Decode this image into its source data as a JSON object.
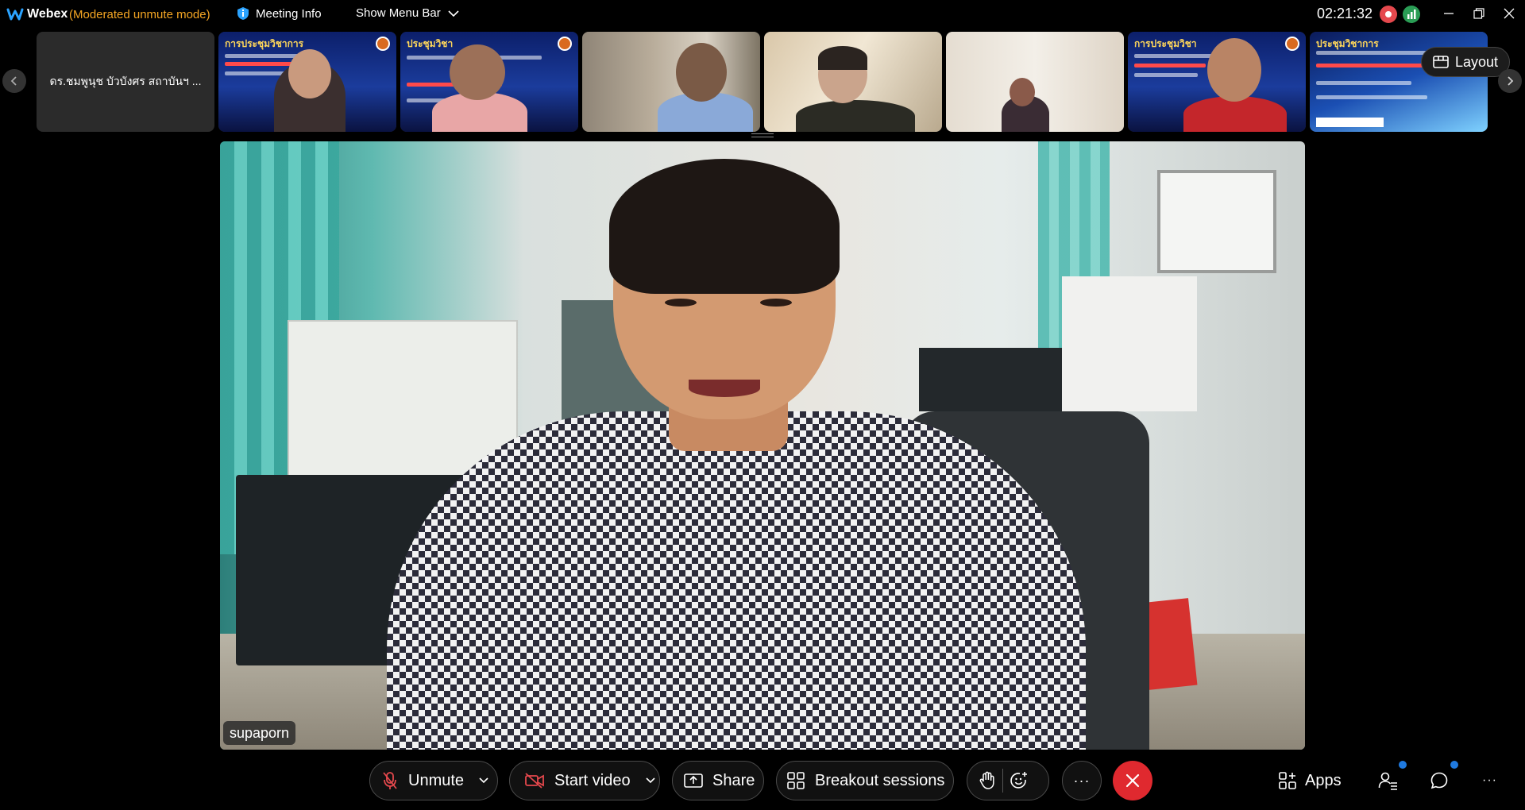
{
  "titlebar": {
    "app_name": "Webex",
    "mode": "(Moderated unmute mode)",
    "meeting_info": "Meeting Info",
    "show_menu_bar": "Show Menu Bar",
    "clock": "02:21:32"
  },
  "thumbnails": [
    {
      "type": "name",
      "name": "ดร.ชมพูนุช บัวบังศร สถาบันฯ ..."
    },
    {
      "type": "slide",
      "slide_title": "การประชุมวิชาการ"
    },
    {
      "type": "slide",
      "slide_title": "ประชุมวิชา"
    },
    {
      "type": "video"
    },
    {
      "type": "video"
    },
    {
      "type": "video"
    },
    {
      "type": "slide",
      "slide_title": "การประชุมวิชา"
    },
    {
      "type": "slide",
      "slide_title": "ประชุมวิชาการ"
    }
  ],
  "layout_label": "Layout",
  "main_video": {
    "participant_name": "supaporn"
  },
  "controls": {
    "unmute": "Unmute",
    "start_video": "Start video",
    "share": "Share",
    "breakout": "Breakout sessions",
    "more": "···",
    "apps": "Apps",
    "overflow": "···"
  },
  "colors": {
    "mode_text": "#f5a623",
    "end_button": "#e0292f",
    "notification": "#1f7ae0",
    "recording": "#e5484d"
  }
}
